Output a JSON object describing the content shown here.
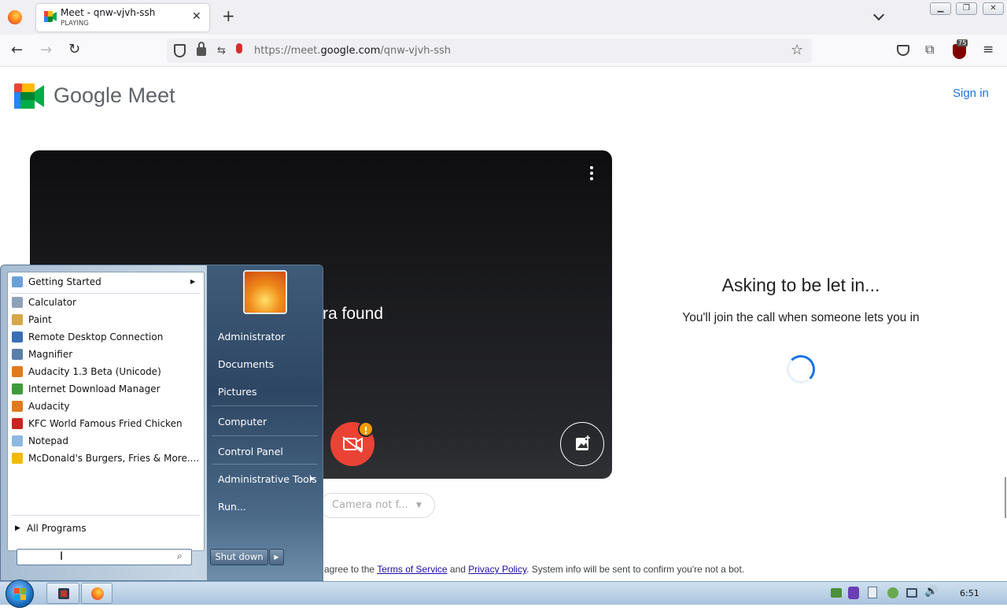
{
  "browser": {
    "tab": {
      "title": "Meet - qnw-vjvh-ssh",
      "subtitle": "PLAYING"
    },
    "url": {
      "scheme": "https://meet.",
      "domain": "google.com",
      "path": "/qnw-vjvh-ssh"
    },
    "extension_badge": "75",
    "new_tab_symbol": "+"
  },
  "page": {
    "brand": "Google Meet",
    "sign_in": "Sign in",
    "camera_message_partial": "ra found",
    "asking_title": "Asking to be let in...",
    "asking_subtitle": "You'll join the call when someone lets you in",
    "camera_select": "Camera not f...",
    "footer": {
      "prefix": "agree to the",
      "terms": "Terms of Service",
      "and": "and",
      "privacy": "Privacy Policy",
      "suffix": ". System info will be sent to confirm you're not a bot."
    },
    "alert_badge": "!"
  },
  "start_menu": {
    "programs": [
      {
        "label": "Getting Started",
        "icon": "getting-started-icon",
        "color": "#6aa0d8",
        "arrow": true
      },
      {
        "label": "Calculator",
        "icon": "calculator-icon",
        "color": "#8da2b8"
      },
      {
        "label": "Paint",
        "icon": "paint-icon",
        "color": "#d7a64a"
      },
      {
        "label": "Remote Desktop Connection",
        "icon": "remote-desktop-icon",
        "color": "#3b6fb3"
      },
      {
        "label": "Magnifier",
        "icon": "magnifier-icon",
        "color": "#5a7fa8"
      },
      {
        "label": "Audacity 1.3 Beta (Unicode)",
        "icon": "audacity-icon",
        "color": "#e07a20"
      },
      {
        "label": "Internet Download Manager",
        "icon": "idm-icon",
        "color": "#3f9a3a"
      },
      {
        "label": "Audacity",
        "icon": "audacity-icon",
        "color": "#e07a20"
      },
      {
        "label": "KFC  World Famous Fried Chicken",
        "icon": "kfc-icon",
        "color": "#c8261f"
      },
      {
        "label": "Notepad",
        "icon": "notepad-icon",
        "color": "#8db9e0"
      },
      {
        "label": "McDonald's  Burgers, Fries & More....",
        "icon": "mcdonalds-icon",
        "color": "#f2b90c"
      }
    ],
    "all_programs": "All Programs",
    "search_placeholder": "",
    "right_items": [
      "Administrator",
      "Documents",
      "Pictures",
      "Computer",
      "Control Panel",
      "Administrative Tools",
      "Run..."
    ],
    "shutdown": "Shut down"
  },
  "taskbar": {
    "clock": "6:51"
  }
}
